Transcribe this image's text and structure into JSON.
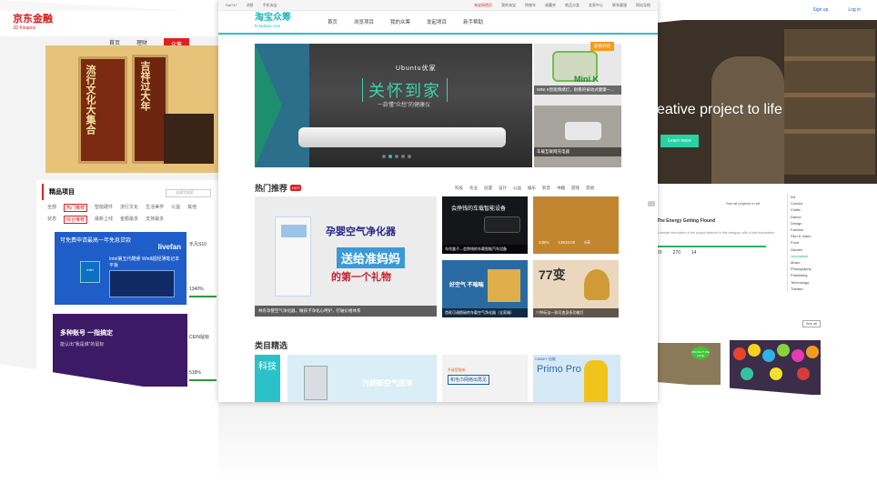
{
  "left": {
    "logo_cn": "京东金融",
    "logo_en": "JD Finance",
    "nav": [
      "首页",
      "理财",
      "众筹"
    ],
    "scroll_texts": [
      "吉祥过大年",
      "流行文化大集合"
    ],
    "section_title": "精品项目",
    "search_placeholder": "关键字搜索",
    "filter_row1": [
      "全部",
      "热门推荐",
      "智能硬件",
      "流行文化",
      "生活美学",
      "公益",
      "其他"
    ],
    "filter_row2": [
      "状态",
      "综合推荐",
      "最新上线",
      "金额最多",
      "支持最多"
    ],
    "card1_text": "可免费申请最高一年免息贷款",
    "card1_brand": "livefan",
    "card1_desc": "Intel第五代酷睿 Win8超轻薄笔记本平板",
    "card2_text": "多种账号 一指搞定",
    "card2_sub": "能认出“我是谁”的鼠标",
    "side_item1_title": "乐凡S10",
    "side_item1_pct": "1340%",
    "side_item2_title": "CEIN鼠标",
    "side_item2_pct": "518%"
  },
  "center": {
    "topbar_left": [
      "Dai747",
      "消息",
      "手机淘宝"
    ],
    "topbar_right": [
      "淘宝网首页",
      "我的淘宝",
      "购物车",
      "收藏夹",
      "商品分类",
      "卖家中心",
      "联系客服",
      "网站导航"
    ],
    "logo_cn": "淘宝众筹",
    "logo_en": "hi.taobao.com",
    "nav": [
      "首页",
      "浏览项目",
      "我的众筹",
      "发起项目",
      "新手帮助"
    ],
    "hero_brand": "Ubuntu优家",
    "hero_slogan": "关怀到家",
    "hero_sub": "一款懂“众愁”的健康仪",
    "side_tag": "即将开始",
    "side1_caption": "MINI K智能情绪灯，耐看的被动式健康一...",
    "side2_caption": "车载互联网充电器",
    "hot_title": "热门推荐",
    "hot_badge": "HOT",
    "filters": [
      "科技",
      "农业",
      "动漫",
      "设计",
      "公益",
      "娱乐",
      "影音",
      "书籍",
      "游戏",
      "其他"
    ],
    "big_lines": [
      "孕婴空气净化器",
      "送给准妈妈",
      "的第一个礼物"
    ],
    "big_caption": "林舟孕婴空气净化器，做孩子净化心呵护，打破价格体系",
    "tile1_title": "会挣钱的车载智能设备",
    "tile1_caption": "车伴盒子—会挣钱的车载智能汽车设备",
    "tile2_stats": [
      "138%",
      "13810.00",
      "8天"
    ],
    "tile2_caption": "",
    "tile3_title": "好空气 不喘喘",
    "tile3_caption": "首款可调换碳的车载空气净化器（全家福）",
    "tile4_big": "77变",
    "tile4_caption": "77种玩法一款可变身多功能灯",
    "cat_title": "类目精选",
    "cat_tech": "科技",
    "cat1_text": "为刷新空气而来",
    "cat2_tag": "升级智能新",
    "cat2_text": "和毛巾网络出再见",
    "cat3_brand": "CANEY 佳能",
    "cat3_text": "Primo Pro"
  },
  "right": {
    "top_links": [
      "Sign up",
      "Log in"
    ],
    "hero_text": "eative project to life",
    "hero_button": "Learn more",
    "mini_label": "See all projects in art",
    "project_title": "The Energy Getting Flound",
    "project_desc": "A sample description of the project featured in this category, with a brief explanation.",
    "stats": [
      "20",
      "270",
      "14"
    ],
    "categories": [
      "Art",
      "Comics",
      "Crafts",
      "Dance",
      "Design",
      "Fashion",
      "Film & Video",
      "Food",
      "Games",
      "Journalism",
      "Music",
      "Photography",
      "Publishing",
      "Technology",
      "Theater"
    ],
    "selected_category": "Journalism",
    "see_all": "See all",
    "badge_text": "PROJECT WE LOVE"
  }
}
